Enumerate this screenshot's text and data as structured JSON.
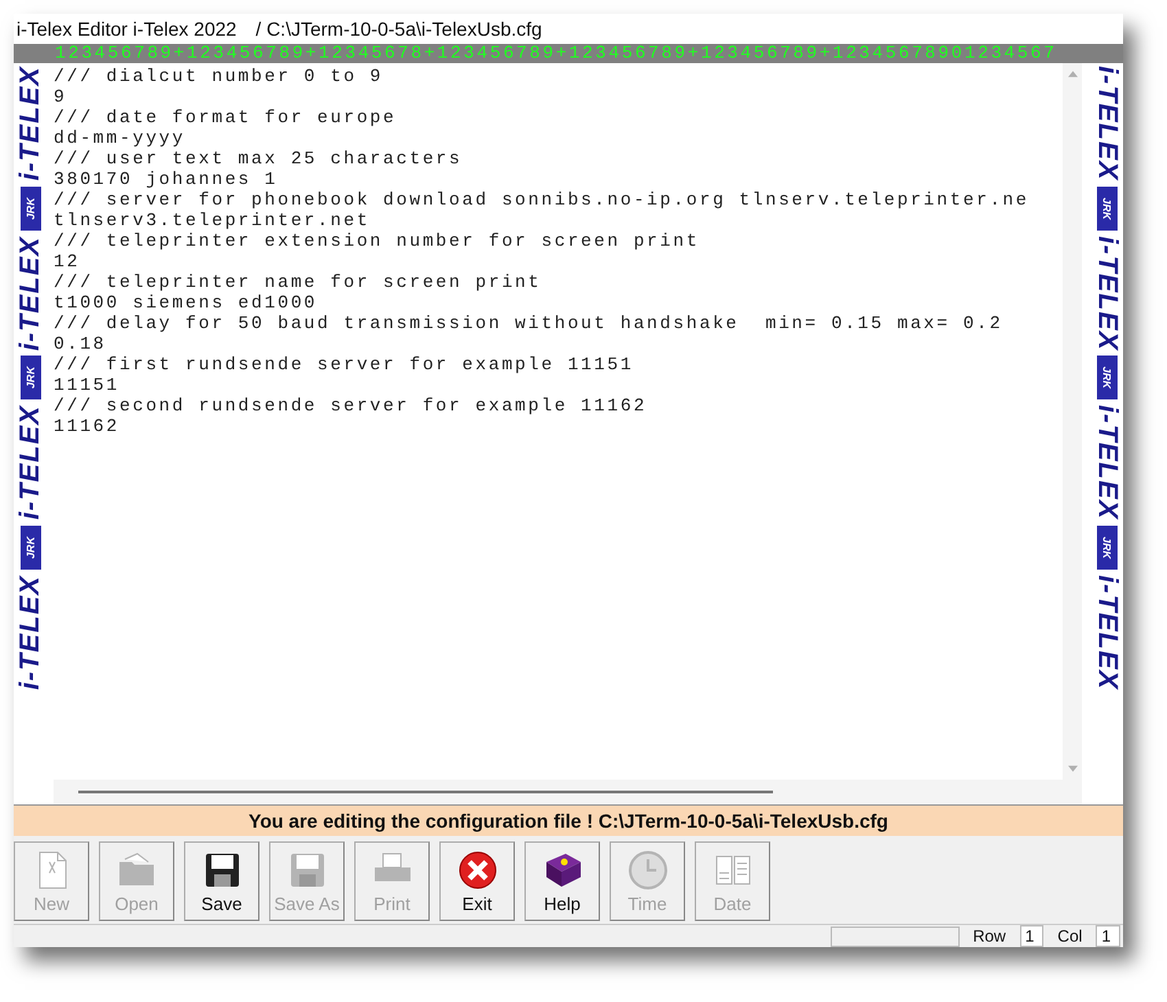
{
  "window": {
    "title": "i-Telex Editor i-Telex 2022",
    "path": "/ C:\\JTerm-10-0-5a\\i-TelexUsb.cfg"
  },
  "ruler": "123456789+123456789+12345678+123456789+123456789+123456789+12345678901234567",
  "left_banner": [
    "i-TELEX",
    "JRK",
    "i-TELEX",
    "JRK",
    "i-TELEX",
    "JRK",
    "i-TELEX"
  ],
  "right_banner": [
    "i-TELEX",
    "JRK",
    "i-TELEX",
    "JRK",
    "i-TELEX",
    "JRK",
    "i-TELEX"
  ],
  "editor": {
    "lines": [
      "/// dialcut number 0 to 9",
      "9",
      "/// date format for europe",
      "dd-mm-yyyy",
      "/// user text max 25 characters",
      "380170 johannes 1",
      "/// server for phonebook download sonnibs.no-ip.org tlnserv.teleprinter.ne",
      "tlnserv3.teleprinter.net",
      "/// teleprinter extension number for screen print",
      "12",
      "/// teleprinter name for screen print",
      "t1000 siemens ed1000",
      "/// delay for 50 baud transmission without handshake  min= 0.15 max= 0.2",
      "0.18",
      "/// first rundsende server for example 11151",
      "11151",
      "/// second rundsende server for example 11162",
      "11162"
    ]
  },
  "message": "You are editing the configuration file ! C:\\JTerm-10-0-5a\\i-TelexUsb.cfg",
  "toolbar": [
    {
      "label": "New",
      "disabled": true
    },
    {
      "label": "Open",
      "disabled": true
    },
    {
      "label": "Save",
      "disabled": false
    },
    {
      "label": "Save As",
      "disabled": true
    },
    {
      "label": "Print",
      "disabled": true
    },
    {
      "label": "Exit",
      "disabled": false
    },
    {
      "label": "Help",
      "disabled": false
    },
    {
      "label": "Time",
      "disabled": true
    },
    {
      "label": "Date",
      "disabled": true
    }
  ],
  "status_bar": {
    "row_label": "Row",
    "row": "1",
    "col_label": "Col",
    "col": "1"
  }
}
